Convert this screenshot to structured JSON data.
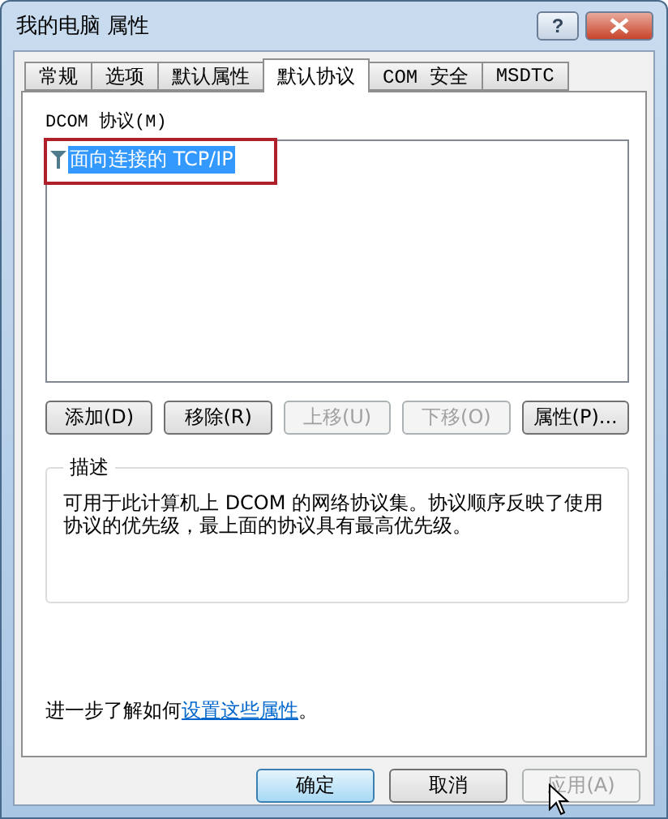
{
  "window": {
    "title": "我的电脑 属性",
    "help_label": "?"
  },
  "tabs": [
    {
      "label": "常规",
      "selected": false
    },
    {
      "label": "选项",
      "selected": false
    },
    {
      "label": "默认属性",
      "selected": false
    },
    {
      "label": "默认协议",
      "selected": true
    },
    {
      "label": "COM 安全",
      "selected": false
    },
    {
      "label": "MSDTC",
      "selected": false
    }
  ],
  "protocols": {
    "label": "DCOM 协议(M)",
    "items": [
      {
        "name": "面向连接的 TCP/IP",
        "selected": true,
        "highlighted": true
      }
    ]
  },
  "list_buttons": [
    {
      "label": "添加(D)",
      "disabled": false
    },
    {
      "label": "移除(R)",
      "disabled": false
    },
    {
      "label": "上移(U)",
      "disabled": true
    },
    {
      "label": "下移(O)",
      "disabled": true
    },
    {
      "label": "属性(P)...",
      "disabled": false
    }
  ],
  "description": {
    "title": "描述",
    "text": "可用于此计算机上 DCOM 的网络协议集。协议顺序反映了使用协议的优先级，最上面的协议具有最高优先级。"
  },
  "help_line": {
    "prefix": "进一步了解如何",
    "link": "设置这些属性",
    "suffix": "。"
  },
  "dialog_buttons": [
    {
      "label": "确定",
      "disabled": false,
      "default": true
    },
    {
      "label": "取消",
      "disabled": false,
      "default": false
    },
    {
      "label": "应用(A)",
      "disabled": true,
      "default": false
    }
  ]
}
